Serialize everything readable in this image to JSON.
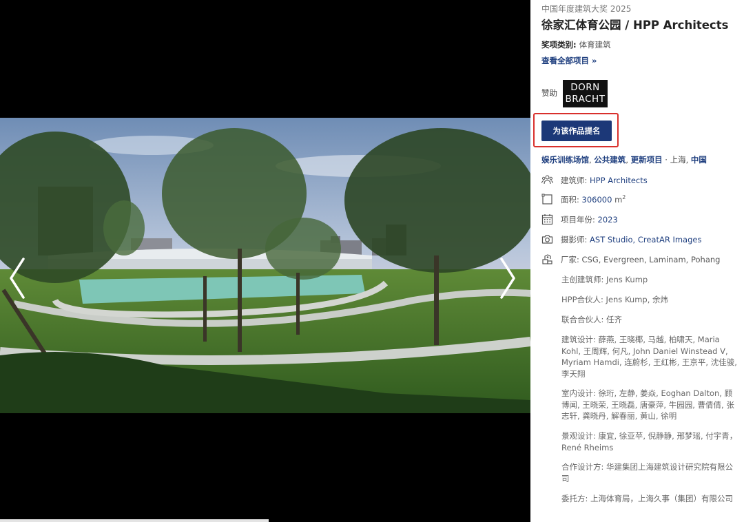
{
  "award": {
    "line": "中国年度建筑大奖 2025"
  },
  "project": {
    "title_cn": "徐家汇体育公园",
    "title_sep": " / ",
    "firm": "HPP Architects",
    "category_label": "奖项类别: ",
    "category_value": "体育建筑",
    "all_projects_link": "查看全部项目 »"
  },
  "sponsor": {
    "label": "赞助",
    "logo_line1": "DORN",
    "logo_line2": "BRACHT"
  },
  "nominate": {
    "button_label": "为该作品提名",
    "highlight_color": "#d9302c",
    "button_color": "#1c3878"
  },
  "tags": {
    "items": [
      "娱乐训练场馆",
      "公共建筑",
      "更新项目"
    ],
    "separator": ", ",
    "location_sep": " · ",
    "city": "上海",
    "country": "中国"
  },
  "meta": {
    "architect_label": "建筑师: ",
    "architect_value": "HPP Architects",
    "area_label": "面积: ",
    "area_value": "306000",
    "area_unit": " m",
    "area_sup": "2",
    "year_label": "项目年份: ",
    "year_value": "2023",
    "photographer_label": "摄影师: ",
    "photographer_value": "AST Studio, CreatAR Images",
    "manufacturer_label": "厂家: ",
    "manufacturer_value": "CSG, Evergreen, Laminam, Pohang"
  },
  "icons": {
    "architect": "people-icon",
    "area": "area-icon",
    "year": "calendar-icon",
    "photographer": "camera-icon",
    "manufacturer": "manufacturer-icon",
    "prev": "chevron-left-icon",
    "next": "chevron-right-icon"
  },
  "credits": [
    "主创建筑师: Jens Kump",
    "HPP合伙人: Jens Kump, 余炜",
    "联合合伙人: 任齐",
    "建筑设计: 薛燕, 王晓椰, 马越, 柏啸天, Maria Kohl, 王周辉, 何凡, John Daniel Winstead V, Myriam Hamdi, 连蔚杉, 王红彬, 王京平, 沈佳骏, 李天翔",
    "室内设计: 徐珩, 左静, 姜焱, Eoghan Dalton, 顾博闻, 王晓荣, 王晓磊, 唐豪萍, 牛园园, 曹倩倩, 张志轩, 龚晓丹, 解春丽, 黄山, 徐明",
    "景观设计: 康宜, 徐亚苹, 倪静静, 邢梦瑶, 付宇青， René Rheims",
    "合作设计方: 华建集团上海建筑设计研究院有限公司",
    "委托方: 上海体育局，上海久事（集团）有限公司"
  ]
}
